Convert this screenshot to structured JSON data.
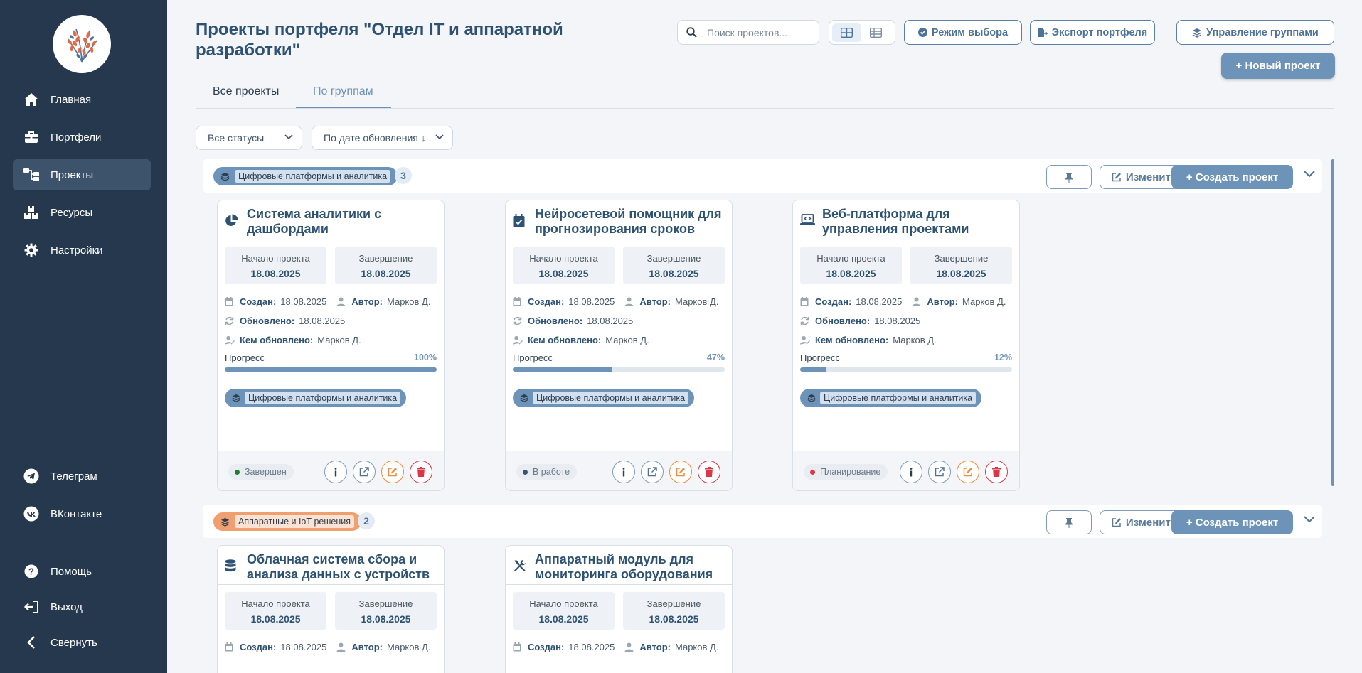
{
  "sidebar": {
    "nav": [
      {
        "label": "Главная",
        "icon": "home-icon"
      },
      {
        "label": "Портфели",
        "icon": "briefcase-icon"
      },
      {
        "label": "Проекты",
        "icon": "sitemap-icon",
        "active": true
      },
      {
        "label": "Ресурсы",
        "icon": "boxes-icon"
      },
      {
        "label": "Настройки",
        "icon": "gear-icon"
      }
    ],
    "social": [
      {
        "label": "Телеграм",
        "icon": "telegram-icon"
      },
      {
        "label": "ВКонтакте",
        "icon": "vk-icon"
      }
    ],
    "bottom": [
      {
        "label": "Помощь",
        "icon": "help-icon"
      },
      {
        "label": "Выход",
        "icon": "logout-icon"
      },
      {
        "label": "Свернуть",
        "icon": "chevron-left-icon"
      }
    ]
  },
  "header": {
    "title": "Проекты портфеля \"Отдел IT и аппаратной разработки\"",
    "search_placeholder": "Поиск проектов...",
    "select_mode": "Режим выбора",
    "export": "Экспорт портфеля",
    "manage_groups": "Управление группами",
    "new_project": "+ Новый проект"
  },
  "tabs": {
    "all": "Все проекты",
    "groups": "По группам",
    "active": "groups"
  },
  "filters": {
    "status": "Все статусы",
    "sort": "По дате обновления ↓"
  },
  "labels": {
    "start": "Начало проекта",
    "end": "Завершение",
    "created": "Создан:",
    "author": "Автор:",
    "updated": "Обновлено:",
    "updated_by": "Кем обновлено:",
    "progress": "Прогресс",
    "edit": "Изменить",
    "create_project": "+ Создать проект"
  },
  "colors": {
    "accent": "#6e93b8",
    "sidebar": "#26384d",
    "danger": "#dc3545",
    "warning": "#f08a3c",
    "success": "#1a7f2e"
  },
  "groups": [
    {
      "name": "Цифровые платформы и аналитика",
      "count": "3",
      "color": "#6e93b8",
      "projects": [
        {
          "title": "Система аналитики с дашбордами",
          "icon": "pie-chart-icon",
          "start": "18.08.2025",
          "end": "18.08.2025",
          "created": "18.08.2025",
          "author": "Марков Д.",
          "updated": "18.08.2025",
          "updated_by": "Марков Д.",
          "progress": "100%",
          "progress_value": 100,
          "tag": "Цифровые платформы и аналитика",
          "status": "Завершен",
          "status_color": "#1a7f2e"
        },
        {
          "title": "Нейросетевой помощник для прогнозирования сроков",
          "icon": "calendar-check-icon",
          "start": "18.08.2025",
          "end": "18.08.2025",
          "created": "18.08.2025",
          "author": "Марков Д.",
          "updated": "18.08.2025",
          "updated_by": "Марков Д.",
          "progress": "47%",
          "progress_value": 47,
          "tag": "Цифровые платформы и аналитика",
          "status": "В работе",
          "status_color": "#3d536b"
        },
        {
          "title": "Веб-платформа для управления проектами",
          "icon": "laptop-code-icon",
          "start": "18.08.2025",
          "end": "18.08.2025",
          "created": "18.08.2025",
          "author": "Марков Д.",
          "updated": "18.08.2025",
          "updated_by": "Марков Д.",
          "progress": "12%",
          "progress_value": 12,
          "tag": "Цифровые платформы и аналитика",
          "status": "Планирование",
          "status_color": "#dc3545"
        }
      ]
    },
    {
      "name": "Аппаратные и IoT-решения",
      "count": "2",
      "color": "#f0a070",
      "projects": [
        {
          "title": "Облачная система сбора и анализа данных с устройств",
          "icon": "database-icon",
          "start": "18.08.2025",
          "end": "18.08.2025",
          "created": "18.08.2025",
          "author": "Марков Д."
        },
        {
          "title": "Аппаратный модуль для мониторинга оборудования",
          "icon": "tools-icon",
          "start": "18.08.2025",
          "end": "18.08.2025",
          "created": "18.08.2025",
          "author": "Марков Д."
        }
      ]
    }
  ]
}
